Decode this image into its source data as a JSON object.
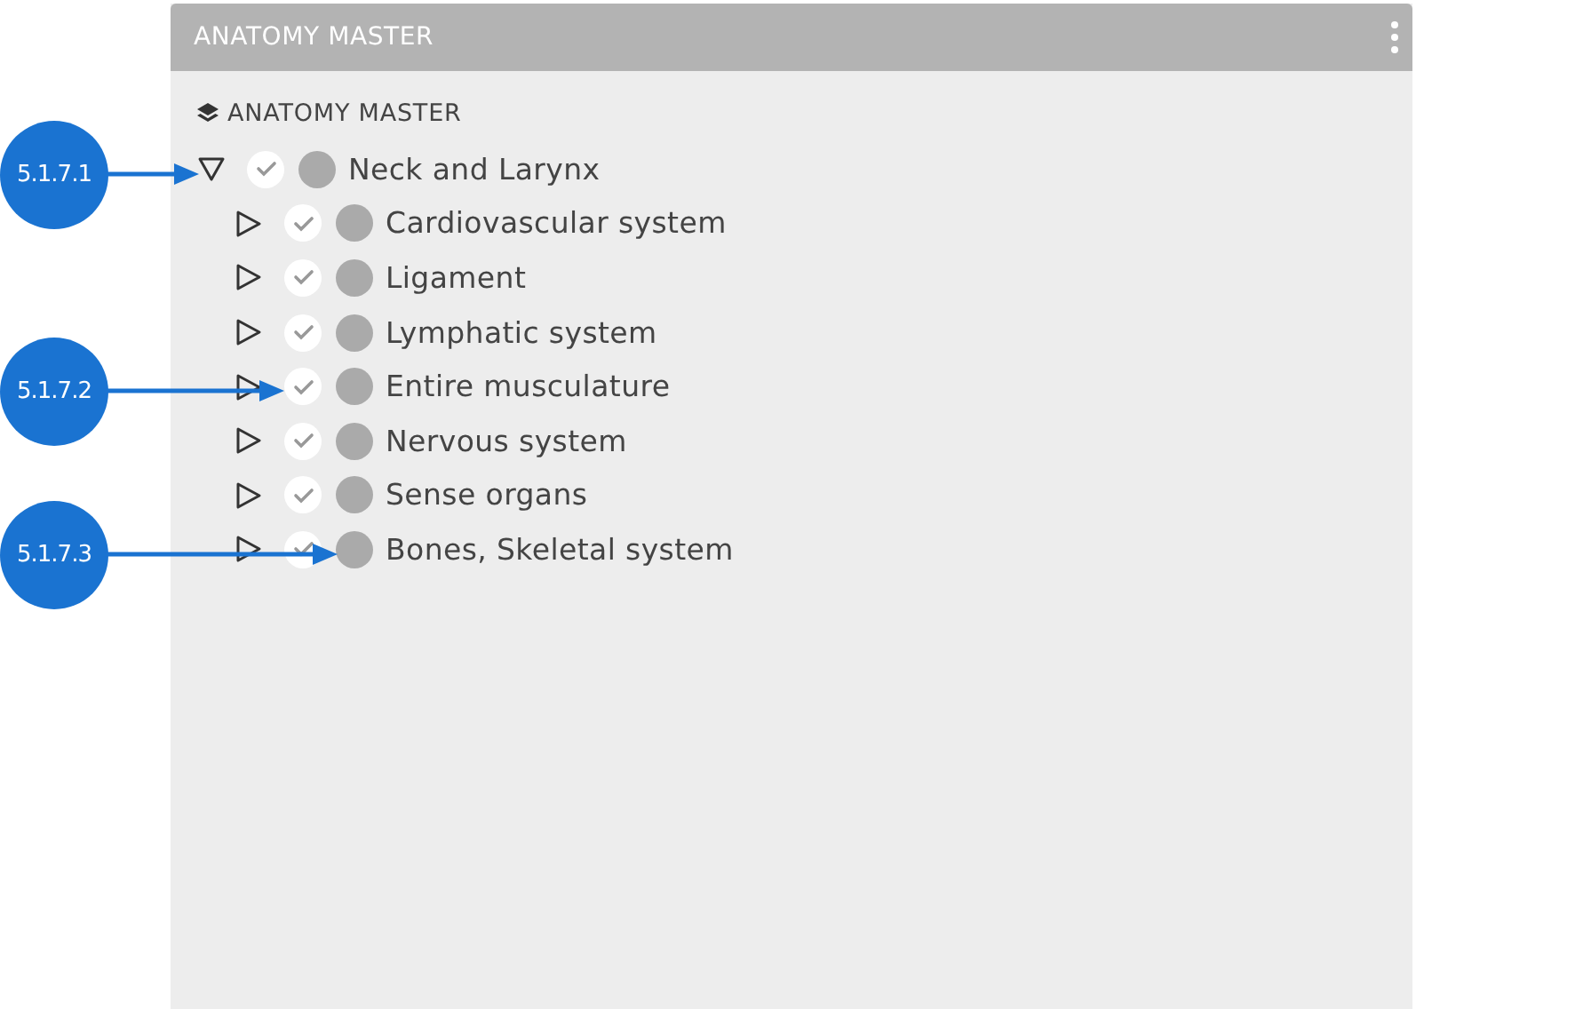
{
  "panel": {
    "title": "ANATOMY MASTER",
    "heading": "ANATOMY MASTER"
  },
  "tree": [
    {
      "label": "Neck and Larynx",
      "expanded": true,
      "checked": true,
      "children": [
        {
          "label": "Cardiovascular system",
          "expanded": false,
          "checked": true
        },
        {
          "label": "Ligament",
          "expanded": false,
          "checked": true
        },
        {
          "label": "Lymphatic system",
          "expanded": false,
          "checked": true
        },
        {
          "label": "Entire musculature",
          "expanded": false,
          "checked": true
        },
        {
          "label": "Nervous system",
          "expanded": false,
          "checked": true
        },
        {
          "label": "Sense organs",
          "expanded": false,
          "checked": true
        },
        {
          "label": "Bones, Skeletal system",
          "expanded": false,
          "checked": true
        }
      ]
    }
  ],
  "callouts": [
    {
      "label": "5.1.7.1"
    },
    {
      "label": "5.1.7.2"
    },
    {
      "label": "5.1.7.3"
    }
  ]
}
